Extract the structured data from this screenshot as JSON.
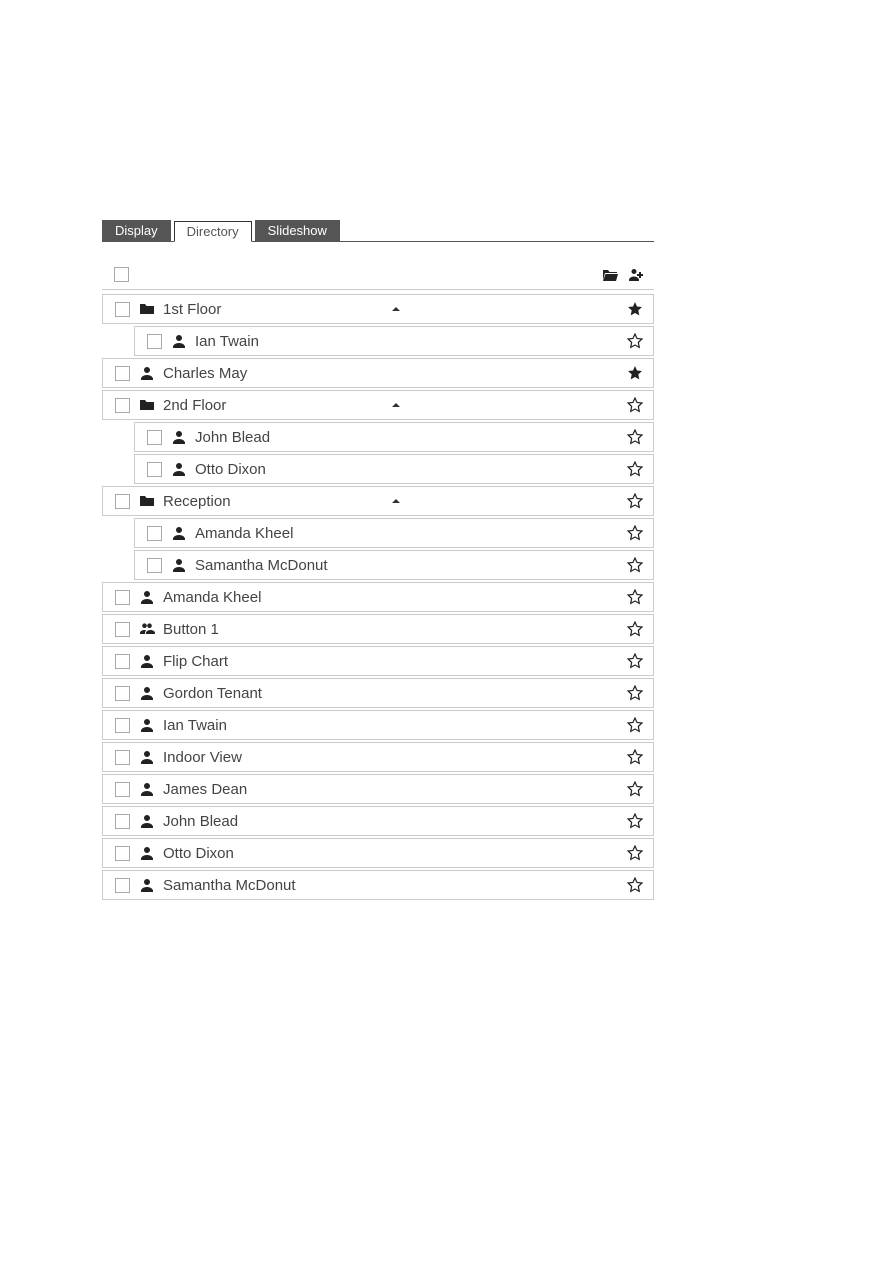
{
  "tabs": {
    "display": "Display",
    "directory": "Directory",
    "slideshow": "Slideshow"
  },
  "rows": [
    {
      "id": "hdr",
      "header": true
    },
    {
      "id": "f1",
      "type": "folder",
      "label": "1st Floor",
      "expanded": true,
      "starred": true
    },
    {
      "id": "f1a",
      "type": "person",
      "label": "Ian Twain",
      "child": true,
      "starred": false
    },
    {
      "id": "cm",
      "type": "person",
      "label": "Charles May",
      "starred": true
    },
    {
      "id": "f2",
      "type": "folder",
      "label": "2nd Floor",
      "expanded": true,
      "starred": false
    },
    {
      "id": "f2a",
      "type": "person",
      "label": "John Blead",
      "child": true,
      "starred": false
    },
    {
      "id": "f2b",
      "type": "person",
      "label": "Otto Dixon",
      "child": true,
      "starred": false
    },
    {
      "id": "rc",
      "type": "folder",
      "label": "Reception",
      "expanded": true,
      "starred": false
    },
    {
      "id": "rca",
      "type": "person",
      "label": "Amanda Kheel",
      "child": true,
      "starred": false
    },
    {
      "id": "rcb",
      "type": "person",
      "label": "Samantha McDonut",
      "child": true,
      "starred": false
    },
    {
      "id": "ak",
      "type": "person",
      "label": "Amanda Kheel",
      "starred": false
    },
    {
      "id": "b1",
      "type": "group",
      "label": "Button 1",
      "starred": false
    },
    {
      "id": "fc",
      "type": "person",
      "label": "Flip Chart",
      "starred": false
    },
    {
      "id": "gt",
      "type": "person",
      "label": "Gordon Tenant",
      "starred": false
    },
    {
      "id": "it",
      "type": "person",
      "label": "Ian Twain",
      "starred": false
    },
    {
      "id": "iv",
      "type": "person",
      "label": "Indoor View",
      "starred": false
    },
    {
      "id": "jd",
      "type": "person",
      "label": "James Dean",
      "starred": false
    },
    {
      "id": "jb",
      "type": "person",
      "label": "John Blead",
      "starred": false
    },
    {
      "id": "od",
      "type": "person",
      "label": "Otto Dixon",
      "starred": false
    },
    {
      "id": "sm",
      "type": "person",
      "label": "Samantha McDonut",
      "starred": false
    }
  ]
}
